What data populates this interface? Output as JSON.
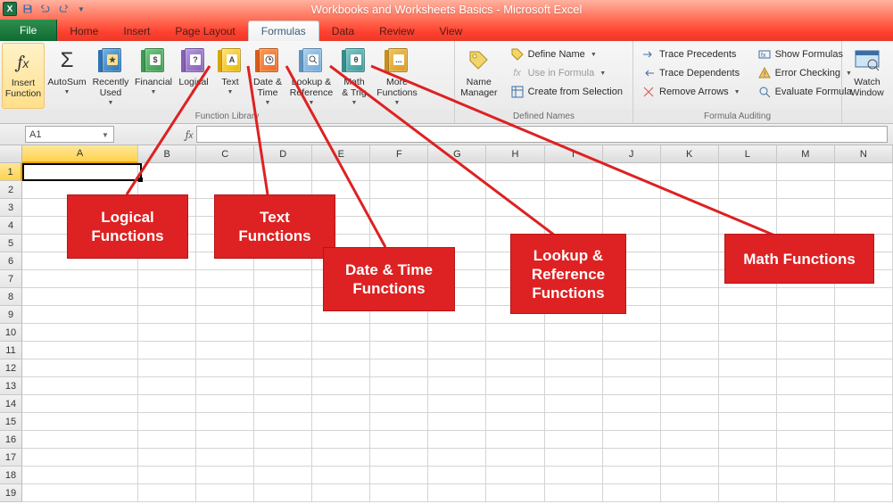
{
  "title": "Workbooks and Worksheets Basics - Microsoft Excel",
  "tabs": {
    "file": "File",
    "home": "Home",
    "insert": "Insert",
    "page": "Page Layout",
    "formulas": "Formulas",
    "data": "Data",
    "review": "Review",
    "view": "View"
  },
  "ribbon": {
    "insert_function": "Insert\nFunction",
    "autosum": "AutoSum",
    "recently": "Recently\nUsed",
    "financial": "Financial",
    "logical": "Logical",
    "text": "Text",
    "datetime": "Date &\nTime",
    "lookup": "Lookup &\nReference",
    "math": "Math\n& Trig",
    "more": "More\nFunctions",
    "group_function_library": "Function Library",
    "name_mgr": "Name\nManager",
    "define_name": "Define Name",
    "use_in_formula": "Use in Formula",
    "create_sel": "Create from Selection",
    "group_defined_names": "Defined Names",
    "trace_prec": "Trace Precedents",
    "trace_dep": "Trace Dependents",
    "remove_arrows": "Remove Arrows",
    "show_formulas": "Show Formulas",
    "error_check": "Error Checking",
    "eval_formula": "Evaluate Formula",
    "group_auditing": "Formula Auditing",
    "watch": "Watch\nWindow"
  },
  "namebox_value": "A1",
  "columns": [
    "A",
    "B",
    "C",
    "D",
    "E",
    "F",
    "G",
    "H",
    "I",
    "J",
    "K",
    "L",
    "M",
    "N"
  ],
  "rows": [
    "1",
    "2",
    "3",
    "4",
    "5",
    "6",
    "7",
    "8",
    "9",
    "10",
    "11",
    "12",
    "13",
    "14",
    "15",
    "16",
    "17",
    "18",
    "19"
  ],
  "callouts": {
    "logical": "Logical\nFunctions",
    "text": "Text\nFunctions",
    "datetime": "Date & Time\nFunctions",
    "lookup": "Lookup & Reference Functions",
    "math": "Math Functions"
  },
  "chart_data": null
}
